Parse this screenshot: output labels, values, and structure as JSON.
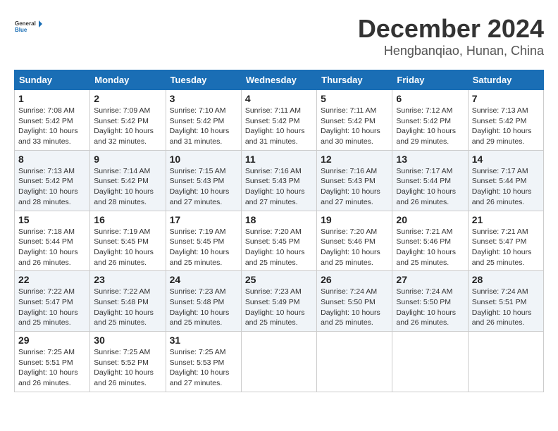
{
  "logo": {
    "text_general": "General",
    "text_blue": "Blue"
  },
  "title": {
    "month": "December 2024",
    "location": "Hengbanqiao, Hunan, China"
  },
  "headers": [
    "Sunday",
    "Monday",
    "Tuesday",
    "Wednesday",
    "Thursday",
    "Friday",
    "Saturday"
  ],
  "weeks": [
    [
      {
        "day": "1",
        "sunrise": "7:08 AM",
        "sunset": "5:42 PM",
        "daylight": "10 hours and 33 minutes."
      },
      {
        "day": "2",
        "sunrise": "7:09 AM",
        "sunset": "5:42 PM",
        "daylight": "10 hours and 32 minutes."
      },
      {
        "day": "3",
        "sunrise": "7:10 AM",
        "sunset": "5:42 PM",
        "daylight": "10 hours and 31 minutes."
      },
      {
        "day": "4",
        "sunrise": "7:11 AM",
        "sunset": "5:42 PM",
        "daylight": "10 hours and 31 minutes."
      },
      {
        "day": "5",
        "sunrise": "7:11 AM",
        "sunset": "5:42 PM",
        "daylight": "10 hours and 30 minutes."
      },
      {
        "day": "6",
        "sunrise": "7:12 AM",
        "sunset": "5:42 PM",
        "daylight": "10 hours and 29 minutes."
      },
      {
        "day": "7",
        "sunrise": "7:13 AM",
        "sunset": "5:42 PM",
        "daylight": "10 hours and 29 minutes."
      }
    ],
    [
      {
        "day": "8",
        "sunrise": "7:13 AM",
        "sunset": "5:42 PM",
        "daylight": "10 hours and 28 minutes."
      },
      {
        "day": "9",
        "sunrise": "7:14 AM",
        "sunset": "5:42 PM",
        "daylight": "10 hours and 28 minutes."
      },
      {
        "day": "10",
        "sunrise": "7:15 AM",
        "sunset": "5:43 PM",
        "daylight": "10 hours and 27 minutes."
      },
      {
        "day": "11",
        "sunrise": "7:16 AM",
        "sunset": "5:43 PM",
        "daylight": "10 hours and 27 minutes."
      },
      {
        "day": "12",
        "sunrise": "7:16 AM",
        "sunset": "5:43 PM",
        "daylight": "10 hours and 27 minutes."
      },
      {
        "day": "13",
        "sunrise": "7:17 AM",
        "sunset": "5:44 PM",
        "daylight": "10 hours and 26 minutes."
      },
      {
        "day": "14",
        "sunrise": "7:17 AM",
        "sunset": "5:44 PM",
        "daylight": "10 hours and 26 minutes."
      }
    ],
    [
      {
        "day": "15",
        "sunrise": "7:18 AM",
        "sunset": "5:44 PM",
        "daylight": "10 hours and 26 minutes."
      },
      {
        "day": "16",
        "sunrise": "7:19 AM",
        "sunset": "5:45 PM",
        "daylight": "10 hours and 26 minutes."
      },
      {
        "day": "17",
        "sunrise": "7:19 AM",
        "sunset": "5:45 PM",
        "daylight": "10 hours and 25 minutes."
      },
      {
        "day": "18",
        "sunrise": "7:20 AM",
        "sunset": "5:45 PM",
        "daylight": "10 hours and 25 minutes."
      },
      {
        "day": "19",
        "sunrise": "7:20 AM",
        "sunset": "5:46 PM",
        "daylight": "10 hours and 25 minutes."
      },
      {
        "day": "20",
        "sunrise": "7:21 AM",
        "sunset": "5:46 PM",
        "daylight": "10 hours and 25 minutes."
      },
      {
        "day": "21",
        "sunrise": "7:21 AM",
        "sunset": "5:47 PM",
        "daylight": "10 hours and 25 minutes."
      }
    ],
    [
      {
        "day": "22",
        "sunrise": "7:22 AM",
        "sunset": "5:47 PM",
        "daylight": "10 hours and 25 minutes."
      },
      {
        "day": "23",
        "sunrise": "7:22 AM",
        "sunset": "5:48 PM",
        "daylight": "10 hours and 25 minutes."
      },
      {
        "day": "24",
        "sunrise": "7:23 AM",
        "sunset": "5:48 PM",
        "daylight": "10 hours and 25 minutes."
      },
      {
        "day": "25",
        "sunrise": "7:23 AM",
        "sunset": "5:49 PM",
        "daylight": "10 hours and 25 minutes."
      },
      {
        "day": "26",
        "sunrise": "7:24 AM",
        "sunset": "5:50 PM",
        "daylight": "10 hours and 25 minutes."
      },
      {
        "day": "27",
        "sunrise": "7:24 AM",
        "sunset": "5:50 PM",
        "daylight": "10 hours and 26 minutes."
      },
      {
        "day": "28",
        "sunrise": "7:24 AM",
        "sunset": "5:51 PM",
        "daylight": "10 hours and 26 minutes."
      }
    ],
    [
      {
        "day": "29",
        "sunrise": "7:25 AM",
        "sunset": "5:51 PM",
        "daylight": "10 hours and 26 minutes."
      },
      {
        "day": "30",
        "sunrise": "7:25 AM",
        "sunset": "5:52 PM",
        "daylight": "10 hours and 26 minutes."
      },
      {
        "day": "31",
        "sunrise": "7:25 AM",
        "sunset": "5:53 PM",
        "daylight": "10 hours and 27 minutes."
      },
      null,
      null,
      null,
      null
    ]
  ]
}
